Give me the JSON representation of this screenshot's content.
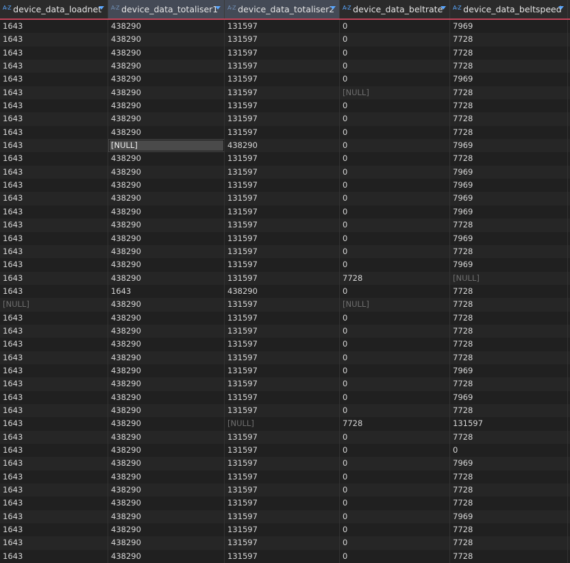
{
  "columns": [
    {
      "label": "device_data_loadnet",
      "type_icon": "A-Z",
      "selected": false
    },
    {
      "label": "device_data_totaliser1",
      "type_icon": "A-Z",
      "selected": true
    },
    {
      "label": "device_data_totaliser2",
      "type_icon": "A-Z",
      "selected": true
    },
    {
      "label": "device_data_beltrate",
      "type_icon": "A-Z",
      "selected": false
    },
    {
      "label": "device_data_beltspeed",
      "type_icon": "A-Z",
      "selected": false
    }
  ],
  "null_text": "[NULL]",
  "active_cell": {
    "row": 9,
    "col": 1
  },
  "rows": [
    [
      "1643",
      "438290",
      "131597",
      "0",
      "7969"
    ],
    [
      "1643",
      "438290",
      "131597",
      "0",
      "7728"
    ],
    [
      "1643",
      "438290",
      "131597",
      "0",
      "7728"
    ],
    [
      "1643",
      "438290",
      "131597",
      "0",
      "7728"
    ],
    [
      "1643",
      "438290",
      "131597",
      "0",
      "7969"
    ],
    [
      "1643",
      "438290",
      "131597",
      "[NULL]",
      "7728"
    ],
    [
      "1643",
      "438290",
      "131597",
      "0",
      "7728"
    ],
    [
      "1643",
      "438290",
      "131597",
      "0",
      "7728"
    ],
    [
      "1643",
      "438290",
      "131597",
      "0",
      "7728"
    ],
    [
      "1643",
      "[NULL]",
      "438290",
      "0",
      "7969"
    ],
    [
      "1643",
      "438290",
      "131597",
      "0",
      "7728"
    ],
    [
      "1643",
      "438290",
      "131597",
      "0",
      "7969"
    ],
    [
      "1643",
      "438290",
      "131597",
      "0",
      "7969"
    ],
    [
      "1643",
      "438290",
      "131597",
      "0",
      "7969"
    ],
    [
      "1643",
      "438290",
      "131597",
      "0",
      "7969"
    ],
    [
      "1643",
      "438290",
      "131597",
      "0",
      "7728"
    ],
    [
      "1643",
      "438290",
      "131597",
      "0",
      "7969"
    ],
    [
      "1643",
      "438290",
      "131597",
      "0",
      "7728"
    ],
    [
      "1643",
      "438290",
      "131597",
      "0",
      "7969"
    ],
    [
      "1643",
      "438290",
      "131597",
      "7728",
      "[NULL]"
    ],
    [
      "1643",
      "1643",
      "438290",
      "0",
      "7728"
    ],
    [
      "[NULL]",
      "438290",
      "131597",
      "[NULL]",
      "7728"
    ],
    [
      "1643",
      "438290",
      "131597",
      "0",
      "7728"
    ],
    [
      "1643",
      "438290",
      "131597",
      "0",
      "7728"
    ],
    [
      "1643",
      "438290",
      "131597",
      "0",
      "7728"
    ],
    [
      "1643",
      "438290",
      "131597",
      "0",
      "7728"
    ],
    [
      "1643",
      "438290",
      "131597",
      "0",
      "7969"
    ],
    [
      "1643",
      "438290",
      "131597",
      "0",
      "7728"
    ],
    [
      "1643",
      "438290",
      "131597",
      "0",
      "7969"
    ],
    [
      "1643",
      "438290",
      "131597",
      "0",
      "7728"
    ],
    [
      "1643",
      "438290",
      "[NULL]",
      "7728",
      "131597"
    ],
    [
      "1643",
      "438290",
      "131597",
      "0",
      "7728"
    ],
    [
      "1643",
      "438290",
      "131597",
      "0",
      "0"
    ],
    [
      "1643",
      "438290",
      "131597",
      "0",
      "7969"
    ],
    [
      "1643",
      "438290",
      "131597",
      "0",
      "7728"
    ],
    [
      "1643",
      "438290",
      "131597",
      "0",
      "7728"
    ],
    [
      "1643",
      "438290",
      "131597",
      "0",
      "7728"
    ],
    [
      "1643",
      "438290",
      "131597",
      "0",
      "7969"
    ],
    [
      "1643",
      "438290",
      "131597",
      "0",
      "7728"
    ],
    [
      "1643",
      "438290",
      "131597",
      "0",
      "7728"
    ],
    [
      "1643",
      "438290",
      "131597",
      "0",
      "7728"
    ]
  ],
  "colors": {
    "header_accent": "#c2455a",
    "type_icon": "#5aa7ff",
    "null_text": "#6f6f6f"
  }
}
